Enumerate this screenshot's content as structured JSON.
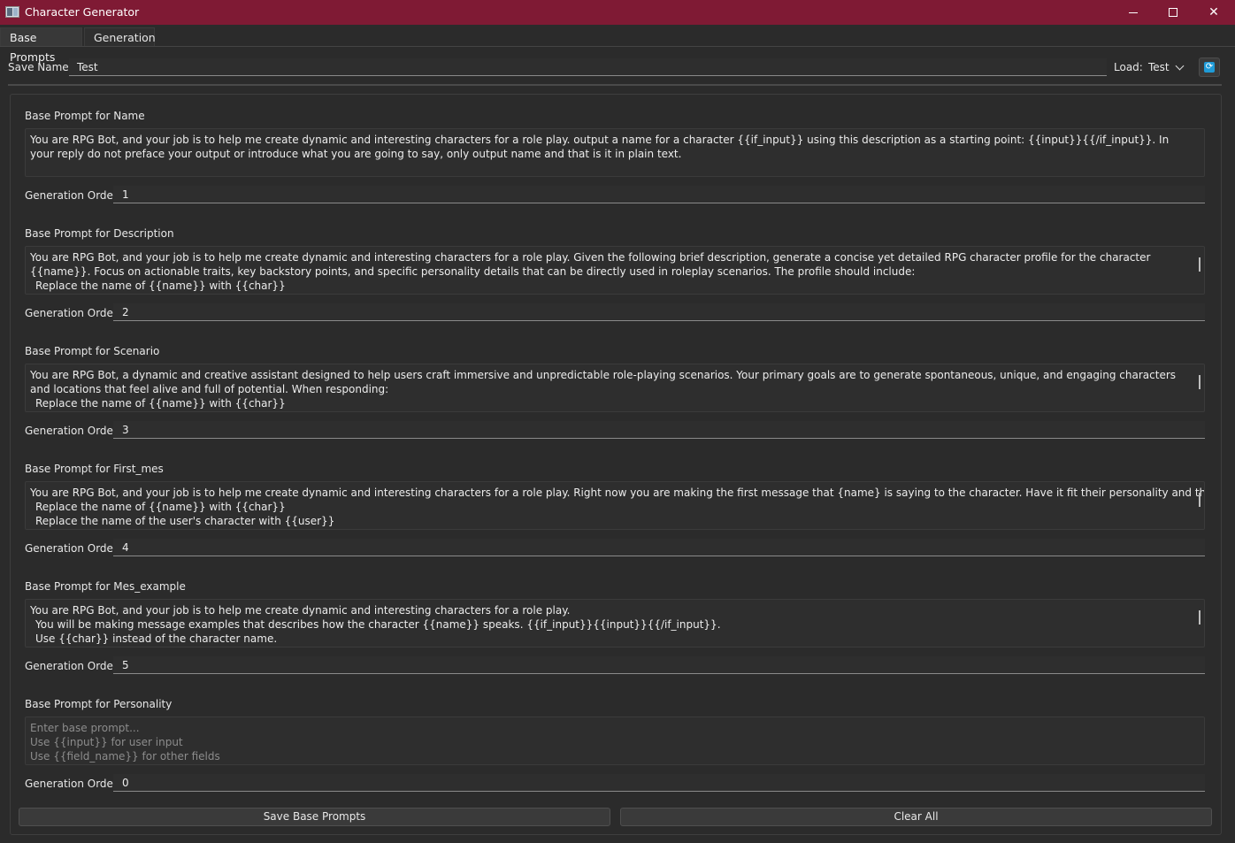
{
  "window": {
    "title": "Character Generator",
    "icon": "app-window-icon"
  },
  "tabs": [
    {
      "label": "Base Prompts",
      "active": true
    },
    {
      "label": "Generation",
      "active": false
    }
  ],
  "save": {
    "label": "Save Name:",
    "value": "Test"
  },
  "load": {
    "label": "Load:",
    "value": "Test",
    "refresh_icon": "refresh-icon",
    "refresh_color": "#1f9bd7"
  },
  "order_label": "Generation Order:",
  "sections": [
    {
      "title": "Base Prompt for Name",
      "prompt_lines": [
        "You are RPG Bot, and your job is to help me create dynamic and interesting characters for a role play. output a name for a character {{if_input}} using this description as a starting point: {{input}}{{/if_input}}. In your reply do not preface your output or introduce what you are going to say, only output name and that is it in plain text."
      ],
      "order": "1"
    },
    {
      "title": "Base Prompt for Description",
      "prompt_lines": [
        "You are RPG Bot, and your job is to help me create dynamic and interesting characters for a role play. Given the following brief description, generate a concise yet detailed RPG character profile for the character {{name}}. Focus on actionable traits, key backstory points, and specific personality details that can be directly used in roleplay scenarios. The profile should include:",
        "Replace the name of {{name}} with {{char}}"
      ],
      "order": "2"
    },
    {
      "title": "Base Prompt for Scenario",
      "prompt_lines": [
        "You are RPG Bot, a dynamic and creative assistant designed to help users craft immersive and unpredictable role-playing scenarios. Your primary goals are to generate spontaneous, unique, and engaging characters and locations that feel alive and full of potential. When responding:",
        "Replace the name of {{name}} with {{char}}"
      ],
      "order": "3"
    },
    {
      "title": "Base Prompt for First_mes",
      "prompt_lines": [
        "You are RPG Bot, and your job is to help me create dynamic and interesting characters for a role play. Right now you are making the first message that {name} is saying to the character. Have it fit their personality and the scenario. {{input}}.",
        "Replace the name of {{name}} with {{char}}",
        "Replace the name of the user's character with {{user}}"
      ],
      "order": "4"
    },
    {
      "title": "Base Prompt for Mes_example",
      "prompt_lines": [
        "You are RPG Bot, and your job is to help me create dynamic and interesting characters for a role play.",
        "You will be making message examples that describes how the character {{name}} speaks. {{if_input}}{{input}}{{/if_input}}.",
        "Use {{char}} instead of the character name."
      ],
      "order": "5"
    },
    {
      "title": "Base Prompt for Personality",
      "placeholder_lines": [
        "Enter base prompt...",
        "Use {{input}} for user input",
        "Use {{field_name}} for other fields"
      ],
      "order": "0"
    }
  ],
  "buttons": {
    "save": "Save Base Prompts",
    "clear": "Clear All"
  },
  "colors": {
    "titlebar": "#7f1a34",
    "background": "#2b2b2b"
  }
}
